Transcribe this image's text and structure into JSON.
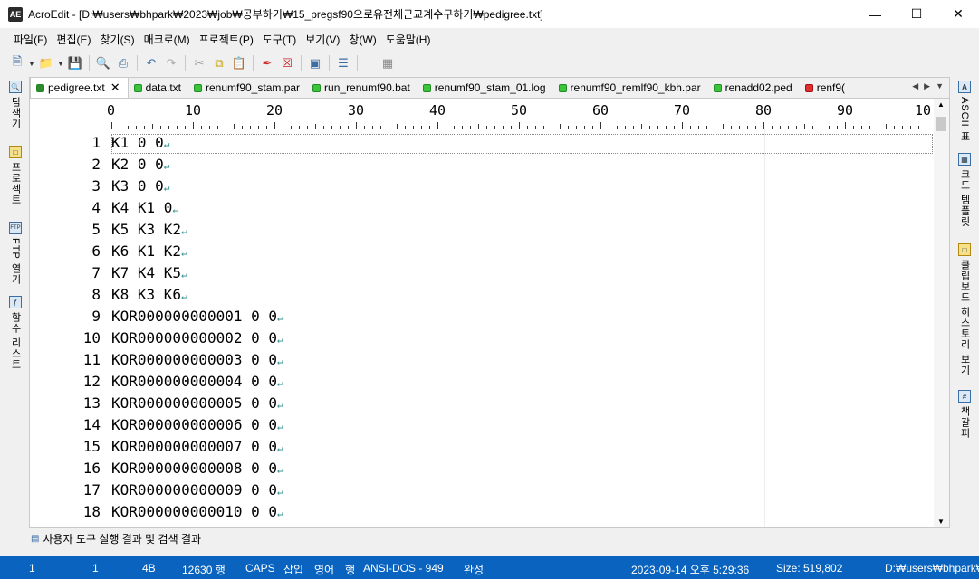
{
  "window": {
    "title": "AcroEdit - [D:₩users₩bhpark₩2023₩job₩공부하기₩15_pregsf90으로유전체근교계수구하기₩pedigree.txt]",
    "app_icon": "AE"
  },
  "menu": [
    "파일(F)",
    "편집(E)",
    "찾기(S)",
    "매크로(M)",
    "프로젝트(P)",
    "도구(T)",
    "보기(V)",
    "창(W)",
    "도움말(H)"
  ],
  "toolbar_icons": [
    "new-file-icon",
    "open-folder-icon",
    "save-icon",
    "print-preview-icon",
    "print-icon",
    "undo-icon",
    "redo-icon",
    "cut-icon",
    "copy-icon",
    "paste-icon",
    "marker-icon",
    "clear-icon",
    "view-icon",
    "list-icon",
    "document-icon"
  ],
  "left_dock": [
    {
      "label": "탐색기",
      "icon": "explorer-icon"
    },
    {
      "label": "프로젝트",
      "icon": "project-icon"
    },
    {
      "label": "FTP 열기",
      "icon": "ftp-icon"
    },
    {
      "label": "함수 리스트",
      "icon": "function-list-icon"
    }
  ],
  "right_dock": [
    {
      "label": "ASCII 표",
      "icon": "ascii-icon"
    },
    {
      "label": "코드 템플릿",
      "icon": "code-template-icon"
    },
    {
      "label": "클립보드 히스토리 보기",
      "icon": "clipboard-icon"
    },
    {
      "label": "책갈피",
      "icon": "bookmark-icon"
    }
  ],
  "tabs": [
    {
      "label": "pedigree.txt",
      "active": true
    },
    {
      "label": "data.txt"
    },
    {
      "label": "renumf90_stam.par"
    },
    {
      "label": "run_renumf90.bat"
    },
    {
      "label": "renumf90_stam_01.log"
    },
    {
      "label": "renumf90_remlf90_kbh.par"
    },
    {
      "label": "renadd02.ped"
    },
    {
      "label": "renf9("
    }
  ],
  "ruler": {
    "labels": [
      "0",
      "10",
      "20",
      "30",
      "40",
      "50",
      "60",
      "70",
      "80",
      "90",
      "10"
    ]
  },
  "lines": [
    {
      "num": "1",
      "text": "K1 0 0"
    },
    {
      "num": "2",
      "text": "K2 0 0"
    },
    {
      "num": "3",
      "text": "K3 0 0"
    },
    {
      "num": "4",
      "text": "K4 K1 0"
    },
    {
      "num": "5",
      "text": "K5 K3 K2"
    },
    {
      "num": "6",
      "text": "K6 K1 K2"
    },
    {
      "num": "7",
      "text": "K7 K4 K5"
    },
    {
      "num": "8",
      "text": "K8 K3 K6"
    },
    {
      "num": "9",
      "text": "KOR000000000001 0 0"
    },
    {
      "num": "10",
      "text": "KOR000000000002 0 0"
    },
    {
      "num": "11",
      "text": "KOR000000000003 0 0"
    },
    {
      "num": "12",
      "text": "KOR000000000004 0 0"
    },
    {
      "num": "13",
      "text": "KOR000000000005 0 0"
    },
    {
      "num": "14",
      "text": "KOR000000000006 0 0"
    },
    {
      "num": "15",
      "text": "KOR000000000007 0 0"
    },
    {
      "num": "16",
      "text": "KOR000000000008 0 0"
    },
    {
      "num": "17",
      "text": "KOR000000000009 0 0"
    },
    {
      "num": "18",
      "text": "KOR000000000010 0 0"
    }
  ],
  "eol_symbol": "↵",
  "bottom_panel": {
    "label": "사용자 도구 실행 결과 및 검색 결과"
  },
  "status": {
    "line": "1",
    "col": "1",
    "size_bytes": "4B",
    "line_count": "12630 행",
    "caps": "CAPS",
    "insert_mode": "삽입",
    "lang": "영어",
    "mode": "행",
    "encoding": "ANSI-DOS - 949",
    "state": "완성",
    "datetime": "2023-09-14 오후 5:29:36",
    "file_size": "Size: 519,802",
    "path": "D:₩users₩bhpark₩"
  },
  "colors": {
    "statusbar": "#0a64bf",
    "tab_dot": "#3cc43c",
    "eol": "#2e8b8b"
  }
}
